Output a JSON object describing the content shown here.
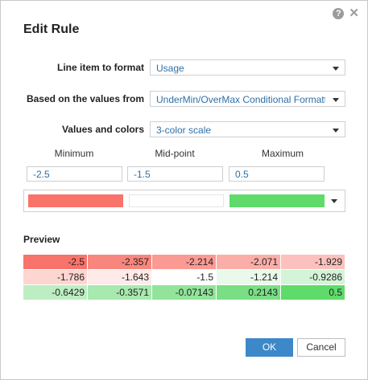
{
  "dialog": {
    "title": "Edit Rule",
    "help_glyph": "?",
    "close_glyph": "✕"
  },
  "fields": {
    "line_item": {
      "label": "Line item to format",
      "value": "Usage"
    },
    "based_on": {
      "label": "Based on the values from",
      "value": "UnderMin/OverMax Conditional Formattir"
    },
    "values_colors": {
      "label": "Values and colors",
      "value": "3-color scale"
    }
  },
  "thresholds": {
    "headers": [
      "Minimum",
      "Mid-point",
      "Maximum"
    ],
    "values": [
      "-2.5",
      "-1.5",
      "0.5"
    ]
  },
  "colors": {
    "minimum": "#f8736a",
    "midpoint": "#ffffff",
    "maximum": "#5fdb6a",
    "accent": "#3d88c9",
    "link_text": "#2f6fa8"
  },
  "preview": {
    "label": "Preview",
    "rows": [
      [
        {
          "text": "-2.5",
          "bg": "#f8736a"
        },
        {
          "text": "-2.357",
          "bg": "#f9867e"
        },
        {
          "text": "-2.214",
          "bg": "#fa9a93"
        },
        {
          "text": "-2.071",
          "bg": "#fbaea8"
        },
        {
          "text": "-1.929",
          "bg": "#fcc1bc"
        }
      ],
      [
        {
          "text": "-1.786",
          "bg": "#fdd5d1"
        },
        {
          "text": "-1.643",
          "bg": "#feeae8"
        },
        {
          "text": "-1.5",
          "bg": "#ffffff"
        },
        {
          "text": "-1.214",
          "bg": "#e9f9ea"
        },
        {
          "text": "-0.9286",
          "bg": "#d3f4d6"
        }
      ],
      [
        {
          "text": "-0.6429",
          "bg": "#bdeec2"
        },
        {
          "text": "-0.3571",
          "bg": "#a7e9ae"
        },
        {
          "text": "-0.07143",
          "bg": "#91e49a"
        },
        {
          "text": "0.2143",
          "bg": "#7ade84"
        },
        {
          "text": "0.5",
          "bg": "#5fdb6a"
        }
      ]
    ]
  },
  "buttons": {
    "ok": "OK",
    "cancel": "Cancel"
  }
}
